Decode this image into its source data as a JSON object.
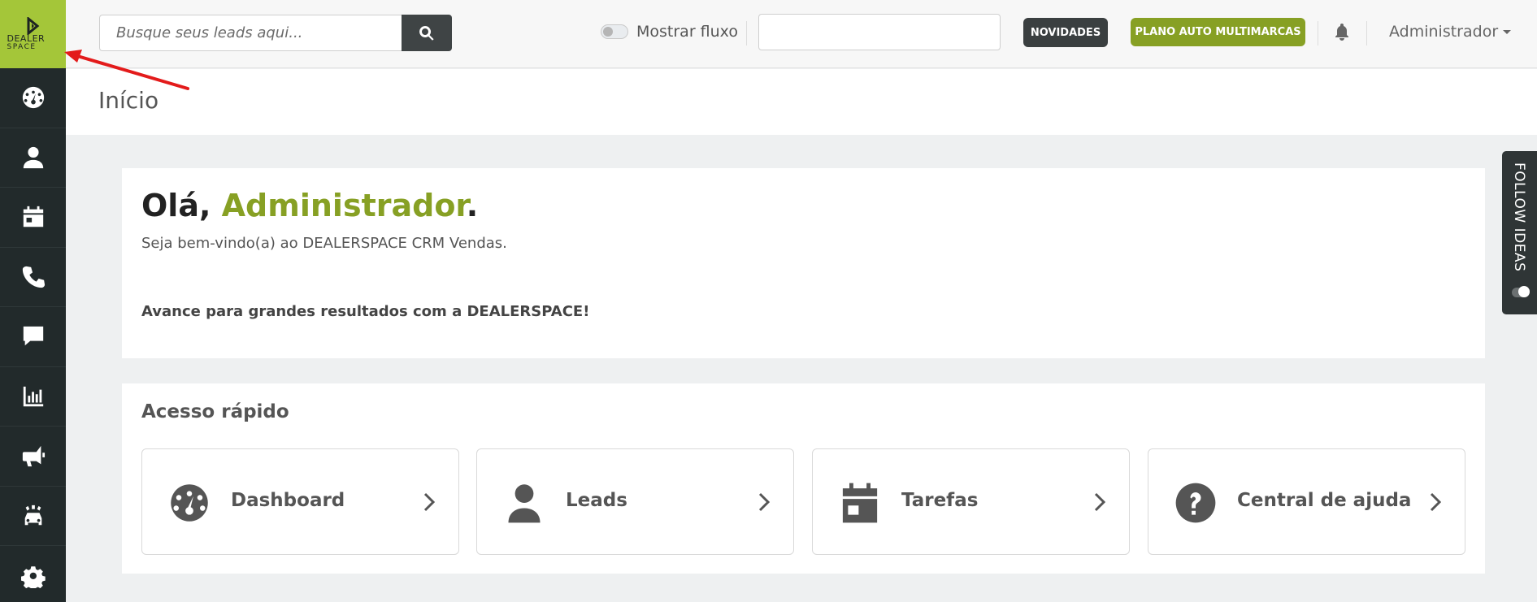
{
  "brand": {
    "logo_line1": "DEALER",
    "logo_line2": "SPACE",
    "accent": "#a4c639",
    "accent_dark": "#87a024"
  },
  "sidebar": {
    "items": [
      {
        "name": "dashboard",
        "icon": "speedometer-icon"
      },
      {
        "name": "leads",
        "icon": "user-icon"
      },
      {
        "name": "tasks",
        "icon": "calendar-icon"
      },
      {
        "name": "calls",
        "icon": "phone-icon"
      },
      {
        "name": "messages",
        "icon": "chat-icon"
      },
      {
        "name": "reports",
        "icon": "bar-chart-icon"
      },
      {
        "name": "campaigns",
        "icon": "megaphone-icon"
      },
      {
        "name": "vehicles",
        "icon": "car-icon"
      },
      {
        "name": "settings",
        "icon": "gear-icon"
      }
    ]
  },
  "header": {
    "search_placeholder": "Busque seus leads aqui...",
    "toggle_label": "Mostrar fluxo",
    "toggle_on": false,
    "novidades_label": "NOVIDADES",
    "plan_label": "PLANO AUTO MULTIMARCAS",
    "user_label": "Administrador"
  },
  "page": {
    "title": "Início"
  },
  "welcome": {
    "greeting": "Olá, ",
    "user_name": "Administrador",
    "period": ".",
    "subtitle": "Seja bem-vindo(a) ao DEALERSPACE CRM Vendas.",
    "cta": "Avance para grandes resultados com a DEALERSPACE!"
  },
  "quick_access": {
    "title": "Acesso rápido",
    "tiles": [
      {
        "label": "Dashboard",
        "icon": "speedometer-icon"
      },
      {
        "label": "Leads",
        "icon": "user-icon"
      },
      {
        "label": "Tarefas",
        "icon": "calendar-icon"
      },
      {
        "label": "Central de ajuda",
        "icon": "question-circle-icon"
      }
    ]
  },
  "follow_ideas": {
    "label": "FOLLOW IDEAS"
  }
}
